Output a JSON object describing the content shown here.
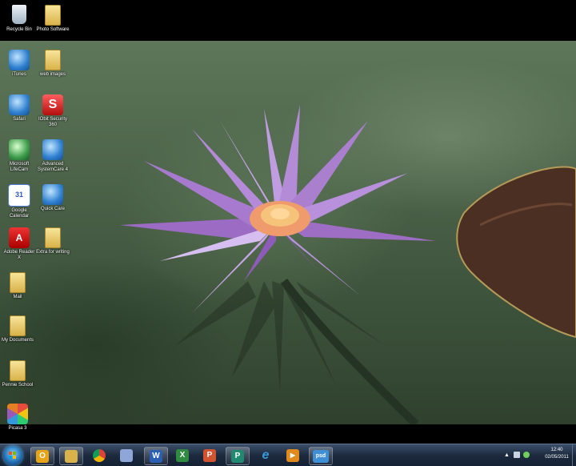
{
  "desktop_icons": [
    {
      "label": "Recycle Bin",
      "icon": "recycle-bin-icon"
    },
    {
      "label": "Photo Software",
      "icon": "folder-icon"
    },
    {
      "label": "iTunes",
      "icon": "itunes-icon"
    },
    {
      "label": "web images",
      "icon": "folder-icon"
    },
    {
      "label": "Safari",
      "icon": "safari-icon"
    },
    {
      "label": "IObit Security 360",
      "icon": "iobit-security-icon"
    },
    {
      "label": "Microsoft LifeCam",
      "icon": "lifecam-icon"
    },
    {
      "label": "Advanced SystemCare 4",
      "icon": "systemcare-icon"
    },
    {
      "label": "Google Calendar",
      "icon": "google-calendar-icon"
    },
    {
      "label": "Quick Care",
      "icon": "quick-care-icon"
    },
    {
      "label": "Adobe Reader X",
      "icon": "adobe-reader-icon"
    },
    {
      "label": "Extra for writing",
      "icon": "folder-icon"
    },
    {
      "label": "Mail",
      "icon": "folder-icon"
    },
    {
      "label": "My Documents",
      "icon": "folder-icon"
    },
    {
      "label": "Pennie School",
      "icon": "folder-icon"
    },
    {
      "label": "Picasa 3",
      "icon": "picasa-icon"
    }
  ],
  "taskbar": {
    "items": [
      {
        "name": "outlook",
        "icon": "outlook-icon",
        "glyph": "O",
        "color": "#e8a317"
      },
      {
        "name": "windows-explorer",
        "icon": "folder-icon",
        "glyph": "",
        "color": "#d9b24a"
      },
      {
        "name": "chrome",
        "icon": "chrome-icon",
        "glyph": "",
        "color": "#4caf50"
      },
      {
        "name": "app",
        "icon": "app-icon",
        "glyph": "",
        "color": "#8fa6d8"
      },
      {
        "name": "word",
        "icon": "word-icon",
        "glyph": "W",
        "color": "#2b5fb4"
      },
      {
        "name": "excel",
        "icon": "excel-icon",
        "glyph": "X",
        "color": "#2e8b3f"
      },
      {
        "name": "powerpoint",
        "icon": "powerpoint-icon",
        "glyph": "P",
        "color": "#d35230"
      },
      {
        "name": "publisher",
        "icon": "publisher-icon",
        "glyph": "P",
        "color": "#1f8a70"
      },
      {
        "name": "internet-explorer",
        "icon": "ie-icon",
        "glyph": "e",
        "color": "#3a9ad9"
      },
      {
        "name": "media-player",
        "icon": "media-player-icon",
        "glyph": "▶",
        "color": "#e08a1e"
      },
      {
        "name": "psd",
        "icon": "psd-icon",
        "glyph": "psd",
        "color": "#3f8fd6"
      }
    ]
  },
  "tray": {
    "time": "12:40",
    "date": "02/05/2011"
  }
}
